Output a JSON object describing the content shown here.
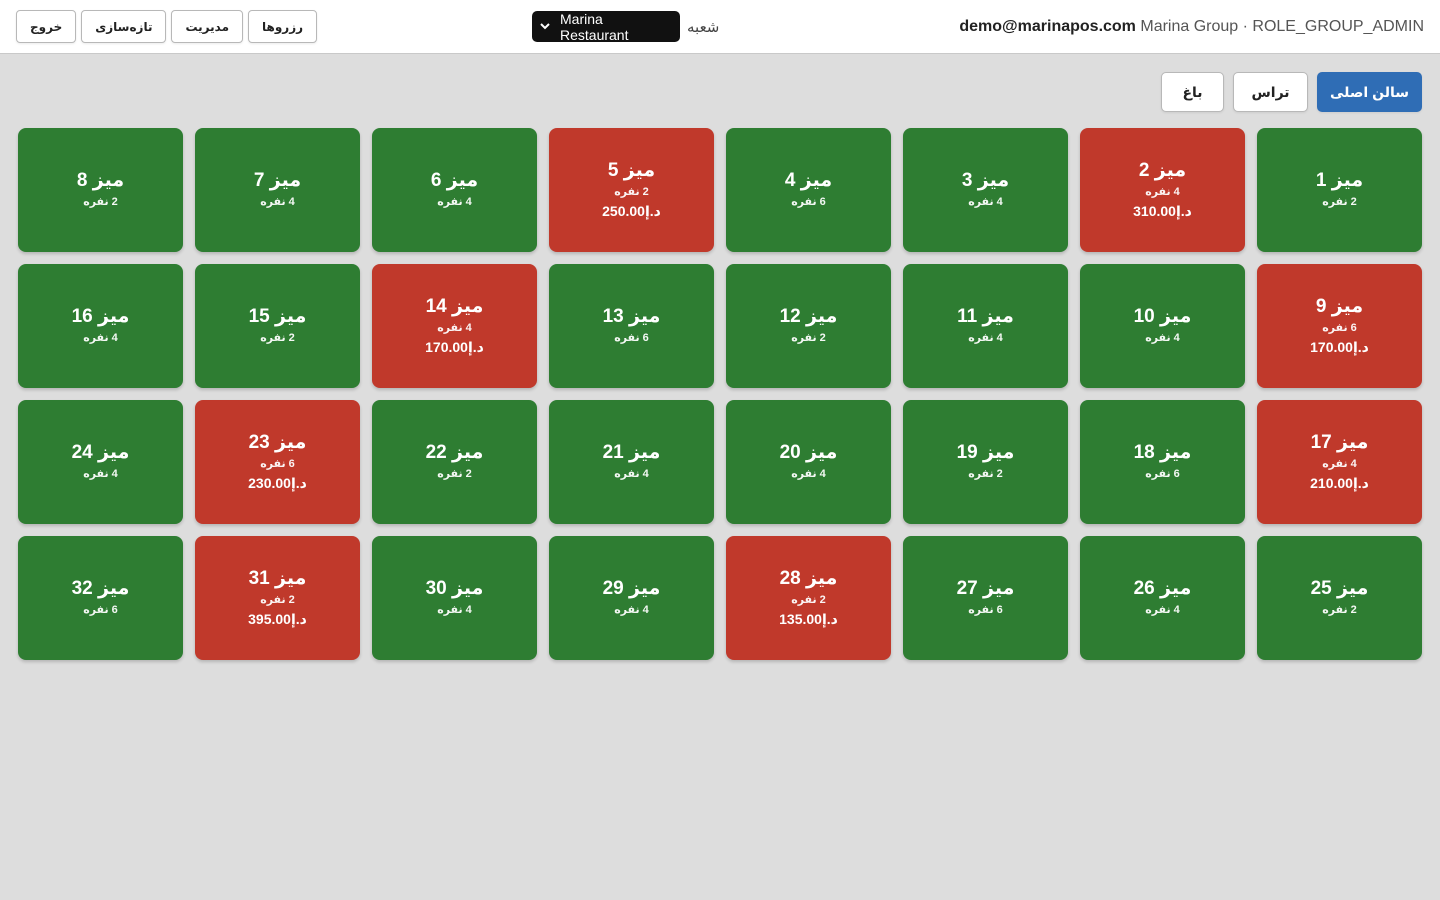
{
  "header": {
    "buttons": [
      {
        "name": "logout-button",
        "label": "خروج"
      },
      {
        "name": "refresh-button",
        "label": "تازه‌سازی"
      },
      {
        "name": "management-button",
        "label": "مدیریت"
      },
      {
        "name": "reservations-button",
        "label": "رزروها"
      }
    ],
    "branch_label": "شعبه",
    "branch_value": "Marina Restaurant",
    "user_email": "demo@marinapos.com",
    "user_meta": "Marina Group · ROLE_GROUP_ADMIN"
  },
  "zones": [
    {
      "label": "سالن اصلی",
      "active": true
    },
    {
      "label": "تراس",
      "active": false
    },
    {
      "label": "باغ",
      "active": false
    }
  ],
  "colors": {
    "free": "#2e7d32",
    "busy": "#c0392b",
    "accent": "#2f6db5"
  },
  "tables": [
    {
      "name": "میز 1",
      "capacity": "2 نفره",
      "status": "free",
      "amount": ""
    },
    {
      "name": "میز 2",
      "capacity": "4 نفره",
      "status": "busy",
      "amount": "310.00د.إ"
    },
    {
      "name": "میز 3",
      "capacity": "4 نفره",
      "status": "free",
      "amount": ""
    },
    {
      "name": "میز 4",
      "capacity": "6 نفره",
      "status": "free",
      "amount": ""
    },
    {
      "name": "میز 5",
      "capacity": "2 نفره",
      "status": "busy",
      "amount": "250.00د.إ"
    },
    {
      "name": "میز 6",
      "capacity": "4 نفره",
      "status": "free",
      "amount": ""
    },
    {
      "name": "میز 7",
      "capacity": "4 نفره",
      "status": "free",
      "amount": ""
    },
    {
      "name": "میز 8",
      "capacity": "2 نفره",
      "status": "free",
      "amount": ""
    },
    {
      "name": "میز 9",
      "capacity": "6 نفره",
      "status": "busy",
      "amount": "170.00د.إ"
    },
    {
      "name": "میز 10",
      "capacity": "4 نفره",
      "status": "free",
      "amount": ""
    },
    {
      "name": "میز 11",
      "capacity": "4 نفره",
      "status": "free",
      "amount": ""
    },
    {
      "name": "میز 12",
      "capacity": "2 نفره",
      "status": "free",
      "amount": ""
    },
    {
      "name": "میز 13",
      "capacity": "6 نفره",
      "status": "free",
      "amount": ""
    },
    {
      "name": "میز 14",
      "capacity": "4 نفره",
      "status": "busy",
      "amount": "170.00د.إ"
    },
    {
      "name": "میز 15",
      "capacity": "2 نفره",
      "status": "free",
      "amount": ""
    },
    {
      "name": "میز 16",
      "capacity": "4 نفره",
      "status": "free",
      "amount": ""
    },
    {
      "name": "میز 17",
      "capacity": "4 نفره",
      "status": "busy",
      "amount": "210.00د.إ"
    },
    {
      "name": "میز 18",
      "capacity": "6 نفره",
      "status": "free",
      "amount": ""
    },
    {
      "name": "میز 19",
      "capacity": "2 نفره",
      "status": "free",
      "amount": ""
    },
    {
      "name": "میز 20",
      "capacity": "4 نفره",
      "status": "free",
      "amount": ""
    },
    {
      "name": "میز 21",
      "capacity": "4 نفره",
      "status": "free",
      "amount": ""
    },
    {
      "name": "میز 22",
      "capacity": "2 نفره",
      "status": "free",
      "amount": ""
    },
    {
      "name": "میز 23",
      "capacity": "6 نفره",
      "status": "busy",
      "amount": "230.00د.إ"
    },
    {
      "name": "میز 24",
      "capacity": "4 نفره",
      "status": "free",
      "amount": ""
    },
    {
      "name": "میز 25",
      "capacity": "2 نفره",
      "status": "free",
      "amount": ""
    },
    {
      "name": "میز 26",
      "capacity": "4 نفره",
      "status": "free",
      "amount": ""
    },
    {
      "name": "میز 27",
      "capacity": "6 نفره",
      "status": "free",
      "amount": ""
    },
    {
      "name": "میز 28",
      "capacity": "2 نفره",
      "status": "busy",
      "amount": "135.00د.إ"
    },
    {
      "name": "میز 29",
      "capacity": "4 نفره",
      "status": "free",
      "amount": ""
    },
    {
      "name": "میز 30",
      "capacity": "4 نفره",
      "status": "free",
      "amount": ""
    },
    {
      "name": "میز 31",
      "capacity": "2 نفره",
      "status": "busy",
      "amount": "395.00د.إ"
    },
    {
      "name": "میز 32",
      "capacity": "6 نفره",
      "status": "free",
      "amount": ""
    }
  ]
}
